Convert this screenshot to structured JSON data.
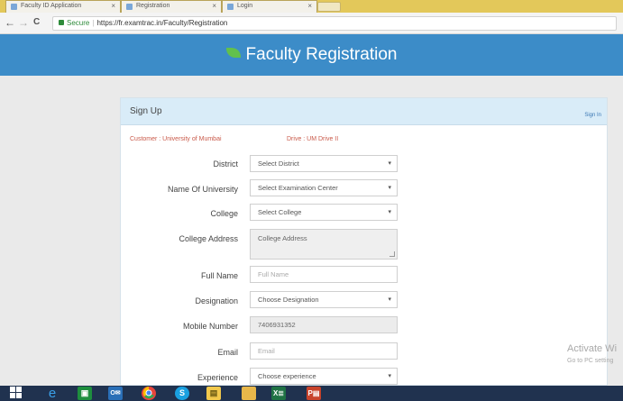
{
  "browser": {
    "tabs": [
      {
        "label": "Faculty ID Application"
      },
      {
        "label": "Registration"
      },
      {
        "label": "Login"
      }
    ],
    "nav": {
      "back": "←",
      "forward": "→",
      "reload": "C"
    },
    "secure_label": "Secure",
    "url": "https://fr.examtrac.in/Faculty/Registration"
  },
  "header": {
    "title": "Faculty Registration",
    "brand_color": "#3c8cc8"
  },
  "panel": {
    "title": "Sign Up",
    "signin_link": "Sign In",
    "customer": "Customer : University of Mumbai",
    "drive": "Drive : UM Drive II"
  },
  "form": {
    "district": {
      "label": "District",
      "value": "Select District"
    },
    "university": {
      "label": "Name Of University",
      "value": "Select Examination Center"
    },
    "college": {
      "label": "College",
      "value": "Select College"
    },
    "college_address": {
      "label": "College Address",
      "value": "College Address"
    },
    "full_name": {
      "label": "Full Name",
      "placeholder": "Full Name"
    },
    "designation": {
      "label": "Designation",
      "value": "Choose Designation"
    },
    "mobile": {
      "label": "Mobile Number",
      "value": "7406931352"
    },
    "email": {
      "label": "Email",
      "placeholder": "Email"
    },
    "experience": {
      "label": "Experience",
      "value": "Choose experience"
    }
  },
  "watermark": {
    "title": "Activate Wi",
    "subtitle": "Go to PC setting"
  },
  "taskbar": {
    "icons": [
      "windows-start-icon",
      "internet-explorer-icon",
      "store-icon",
      "outlook-icon",
      "chrome-icon",
      "skype-icon",
      "file-explorer-icon",
      "folder-icon",
      "excel-icon",
      "powerpoint-icon"
    ]
  }
}
